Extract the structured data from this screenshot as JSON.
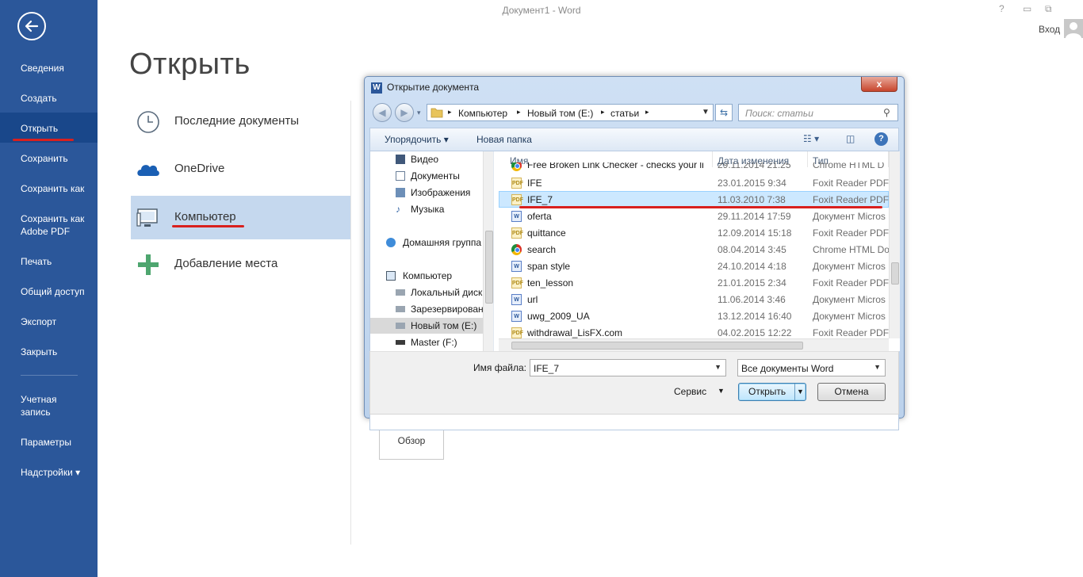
{
  "window": {
    "title": "Документ1 - Word",
    "controls": [
      "?",
      "▭",
      "⧉"
    ],
    "signin": "Вход"
  },
  "sidebar": {
    "items": [
      {
        "label": "Сведения"
      },
      {
        "label": "Создать"
      },
      {
        "label": "Открыть"
      },
      {
        "label": "Сохранить"
      },
      {
        "label": "Сохранить как"
      },
      {
        "label": "Сохранить как",
        "label2": "Adobe PDF"
      },
      {
        "label": "Печать"
      },
      {
        "label": "Общий доступ"
      },
      {
        "label": "Экспорт"
      },
      {
        "label": "Закрыть"
      },
      {
        "label": "Учетная",
        "label2": "запись"
      },
      {
        "label": "Параметры"
      },
      {
        "label": "Надстройки ▾"
      }
    ],
    "active_index": 2
  },
  "open": {
    "title": "Открыть",
    "places": [
      {
        "label": "Последние документы",
        "icon": "clock-icon"
      },
      {
        "label": "OneDrive",
        "icon": "cloud-icon"
      },
      {
        "label": "Компьютер",
        "icon": "computer-icon"
      },
      {
        "label": "Добавление места",
        "icon": "plus-icon"
      }
    ],
    "selected_place": 2,
    "browse_label": "Обзор"
  },
  "dialog": {
    "title": "Открытие документа",
    "close": "x",
    "breadcrumb": [
      "Компьютер",
      "Новый том (E:)",
      "статьи"
    ],
    "search_placeholder": "Поиск: статьи",
    "toolbar": {
      "organize": "Упорядочить ▾",
      "new_folder": "Новая папка"
    },
    "nav_items": [
      {
        "label": "Видео",
        "indent": 1,
        "icon": "video-icon"
      },
      {
        "label": "Документы",
        "indent": 1,
        "icon": "documents-icon"
      },
      {
        "label": "Изображения",
        "indent": 1,
        "icon": "images-icon"
      },
      {
        "label": "Музыка",
        "indent": 1,
        "icon": "music-icon"
      },
      {
        "label": "Домашняя группа",
        "indent": 0,
        "icon": "homegroup-icon"
      },
      {
        "label": "Компьютер",
        "indent": 0,
        "icon": "computer-icon"
      },
      {
        "label": "Локальный диск",
        "indent": 1,
        "icon": "drive-icon"
      },
      {
        "label": "Зарезервирован",
        "indent": 1,
        "icon": "drive-icon"
      },
      {
        "label": "Новый том (E:)",
        "indent": 1,
        "icon": "drive-icon",
        "selected": true
      },
      {
        "label": "Master (F:)",
        "indent": 1,
        "icon": "usb-drive-icon"
      }
    ],
    "columns": {
      "name": "Имя",
      "date": "Дата изменения",
      "type": "Тип"
    },
    "files": [
      {
        "name": "Free Broken Link Checker - checks your li",
        "date": "29.11.2014 21:25",
        "type": "Chrome HTML D",
        "icon": "chrome"
      },
      {
        "name": "IFE",
        "date": "23.01.2015 9:34",
        "type": "Foxit Reader PDF",
        "icon": "pdf"
      },
      {
        "name": "IFE_7",
        "date": "11.03.2010 7:38",
        "type": "Foxit Reader PDF",
        "icon": "pdf",
        "selected": true
      },
      {
        "name": "oferta",
        "date": "29.11.2014 17:59",
        "type": "Документ Micros",
        "icon": "doc"
      },
      {
        "name": "quittance",
        "date": "12.09.2014 15:18",
        "type": "Foxit Reader PDF",
        "icon": "pdf"
      },
      {
        "name": "search",
        "date": "08.04.2014 3:45",
        "type": "Chrome HTML Do",
        "icon": "chrome"
      },
      {
        "name": "span style",
        "date": "24.10.2014 4:18",
        "type": "Документ Micros",
        "icon": "doc"
      },
      {
        "name": "ten_lesson",
        "date": "21.01.2015 2:34",
        "type": "Foxit Reader PDF",
        "icon": "pdf"
      },
      {
        "name": "url",
        "date": "11.06.2014 3:46",
        "type": "Документ Micros",
        "icon": "doc"
      },
      {
        "name": "uwg_2009_UA",
        "date": "13.12.2014 16:40",
        "type": "Документ Micros",
        "icon": "doc"
      },
      {
        "name": "withdrawal_LisFX.com",
        "date": "04.02.2015 12:22",
        "type": "Foxit Reader PDF",
        "icon": "pdf"
      }
    ],
    "filename_label": "Имя файла:",
    "filename_value": "IFE_7",
    "filetype_value": "Все документы Word",
    "service_label": "Сервис",
    "open_button": "Открыть",
    "cancel_button": "Отмена"
  },
  "colors": {
    "sidebar": "#2b579a",
    "highlight": "#d9201e",
    "selected_place": "#c5d8ee"
  }
}
